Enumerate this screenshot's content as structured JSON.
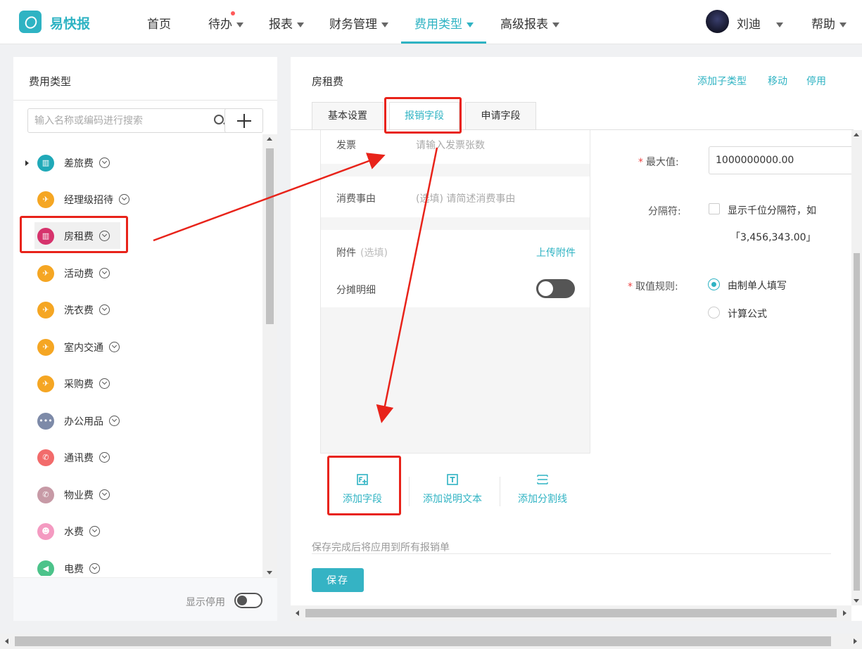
{
  "nav": {
    "brand": "易快报",
    "items": [
      {
        "label": "首页",
        "has_caret": false
      },
      {
        "label": "待办",
        "has_caret": true
      },
      {
        "label": "报表",
        "has_caret": true
      },
      {
        "label": "财务管理",
        "has_caret": true
      },
      {
        "label": "费用类型",
        "has_caret": true,
        "active": true
      },
      {
        "label": "高级报表",
        "has_caret": true
      }
    ],
    "user": "刘迪",
    "help": "帮助",
    "accent": "#2fb3c3"
  },
  "left_panel": {
    "title": "费用类型",
    "search_placeholder": "输入名称或编码进行搜索",
    "categories": [
      {
        "label": "差旅费",
        "icon": "building-icon",
        "color": "#20a9b8"
      },
      {
        "label": "经理级招待",
        "icon": "plane-icon",
        "color": "#f5a623"
      },
      {
        "label": "房租费",
        "icon": "building-icon",
        "color": "#d6336c",
        "selected": true
      },
      {
        "label": "活动费",
        "icon": "plane-icon",
        "color": "#f5a623"
      },
      {
        "label": "洗衣费",
        "icon": "plane-icon",
        "color": "#f5a623"
      },
      {
        "label": "室内交通",
        "icon": "plane-icon",
        "color": "#f5a623"
      },
      {
        "label": "采购费",
        "icon": "plane-icon",
        "color": "#f5a623"
      },
      {
        "label": "办公用品",
        "icon": "dots-icon",
        "color": "#7d8aa8"
      },
      {
        "label": "通讯费",
        "icon": "phone-icon",
        "color": "#f26b6b"
      },
      {
        "label": "物业费",
        "icon": "phone-icon",
        "color": "#c79aa6"
      },
      {
        "label": "水费",
        "icon": "people-icon",
        "color": "#f49ac1"
      },
      {
        "label": "电费",
        "icon": "megaphone-icon",
        "color": "#4cc38a"
      }
    ],
    "show_disabled_label": "显示停用"
  },
  "right_panel": {
    "title": "房租费",
    "actions": {
      "add_subtype": "添加子类型",
      "move": "移动",
      "disable": "停用"
    },
    "tabs": [
      {
        "label": "基本设置",
        "active": false
      },
      {
        "label": "报销字段",
        "active": true
      },
      {
        "label": "申请字段",
        "active": false
      }
    ],
    "fields": {
      "invoice": {
        "label": "发票",
        "placeholder": "请输入发票张数"
      },
      "reason": {
        "label": "消费事由",
        "placeholder": "(选填) 请简述消费事由"
      },
      "attachment": {
        "label": "附件",
        "optional": "(选填)",
        "upload": "上传附件"
      },
      "split": {
        "label": "分摊明细",
        "toggle_on": false
      }
    },
    "toolbar": {
      "add_field": "添加字段",
      "add_text": "添加说明文本",
      "add_divider": "添加分割线"
    },
    "properties": {
      "max_label": "最大值:",
      "max_value": "1000000000.00",
      "separator_label": "分隔符:",
      "separator_text": "显示千位分隔符，如",
      "separator_example": "「3,456,343.00」",
      "rule_label": "取值规则:",
      "rule_options": [
        {
          "label": "由制单人填写",
          "selected": true
        },
        {
          "label": "计算公式",
          "selected": false
        }
      ]
    },
    "hint": "保存完成后将应用到所有报销单",
    "save": "保存"
  },
  "annotation_color": "#e8231a"
}
